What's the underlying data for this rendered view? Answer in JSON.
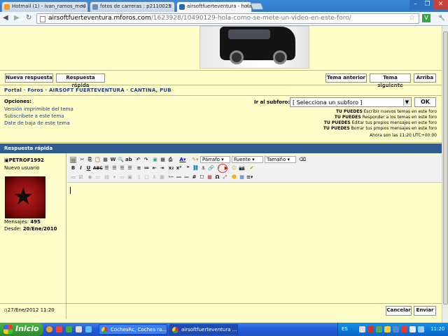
{
  "browser": {
    "tabs": [
      {
        "label": "Hotmail (1) - ivan_ramos_med",
        "active": false
      },
      {
        "label": "fotos de carreras : p2110025",
        "active": false
      },
      {
        "label": "airsoftfuerteventura - hola ,",
        "active": true
      }
    ],
    "url_domain": "airsoftfuerteventura.mforos.com",
    "url_path": "/1623928/10490129-hola-como-se-mete-un-video-en-este-foro/"
  },
  "forum": {
    "buttons_left": [
      "Nueva respuesta",
      "Respuesta rápida"
    ],
    "buttons_right": [
      "Tema anterior",
      "Tema siguiente",
      "Arriba"
    ],
    "breadcrumb": "Portal · Foros · AIRSOFT FUERTEVENTURA · CANTINA, PUB",
    "options_title": "Opciones:",
    "options_links": [
      "Versión imprimible del tema",
      "Subscríbete a este tema",
      "Date de baja de este tema"
    ],
    "subforo_label": "Ir al subforo:",
    "subforo_value": "[ Selecciona un subforo ]",
    "ok_label": "OK",
    "permissions": [
      {
        "b": "TU PUEDES",
        "t": "Escribir nuevos temas en este foro"
      },
      {
        "b": "TU PUEDES",
        "t": "Responder a los temas en este foro"
      },
      {
        "b": "TU PUEDES",
        "t": "Editar tus propios mensajes en este foro"
      },
      {
        "b": "TU PUEDES",
        "t": "Borrar tus propios mensajes en este foro"
      }
    ],
    "time_text": "Ahora son las 11:20",
    "timezone": "UTC+00:00",
    "quick_reply_title": "Respuesta rápida",
    "user": {
      "name": "PETROF1992",
      "rank": "Nuevo usuario",
      "messages_label": "Mensajes:",
      "messages": "495",
      "since_label": "Desde:",
      "since": "20/Ene/2010"
    },
    "editor": {
      "format_select": "Párrafo",
      "font_select": "Fuente",
      "size_select": "Tamaño"
    },
    "post_date": "27/Ene/2012 11:20",
    "cancel_label": "Cancelar",
    "send_label": "Enviar"
  },
  "taskbar": {
    "start_label": "Inicio",
    "items": [
      "CochesRc, Coches ra...",
      "airsoftfuerteventura ..."
    ],
    "lang": "ES",
    "clock": "11:20"
  },
  "colors": {
    "forum_bg": "#fffec9",
    "header_blue": "#2f5d91",
    "taskbar": "#245edb"
  }
}
